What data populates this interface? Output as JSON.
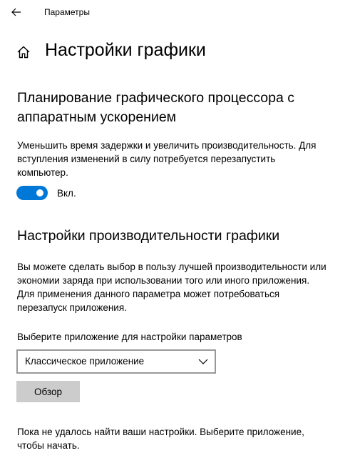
{
  "window": {
    "title": "Параметры",
    "back_icon": "arrow-left-icon"
  },
  "header": {
    "home_icon": "home-icon",
    "title": "Настройки графики"
  },
  "gpu_scheduling": {
    "title_lines": [
      "Планирование графического процессора с",
      "аппаратным ускорением"
    ],
    "description_lines": [
      "Уменьшить время задержки и увеличить производительность. Для",
      "вступления изменений в силу потребуется перезапустить",
      "компьютер."
    ],
    "toggle": {
      "state": "on",
      "label": "Вкл."
    }
  },
  "performance": {
    "title": "Настройки производительности графики",
    "description_lines": [
      "Вы можете сделать выбор в пользу лучшей производительности или",
      "экономии заряда при использовании того или иного приложения.",
      "Для применения данного параметра может потребоваться",
      "перезапуск приложения."
    ],
    "select_label": "Выберите приложение для настройки параметров",
    "select_value": "Классическое приложение",
    "browse_button": "Обзор",
    "footer_lines": [
      "Пока не удалось найти ваши настройки. Выберите приложение,",
      "чтобы начать."
    ]
  },
  "colors": {
    "accent": "#0078d7",
    "button_bg": "#cccccc",
    "select_border": "#999999",
    "background": "#ffffff"
  }
}
